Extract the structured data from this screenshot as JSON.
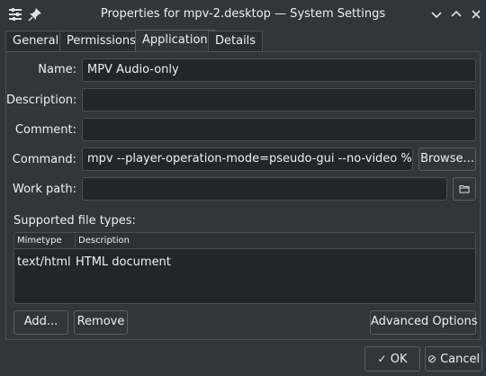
{
  "window": {
    "title": "Properties for mpv-2.desktop — System Settings",
    "icons": [
      "settings-icon",
      "pin-icon",
      "minimize-icon",
      "maximize-icon",
      "close-icon"
    ]
  },
  "tabs": [
    {
      "label": "General",
      "active": false
    },
    {
      "label": "Permissions",
      "active": false
    },
    {
      "label": "Application",
      "active": true
    },
    {
      "label": "Details",
      "active": false
    }
  ],
  "form": {
    "name_label": "Name:",
    "name_value": "MPV Audio-only",
    "description_label": "Description:",
    "description_value": "",
    "comment_label": "Comment:",
    "comment_value": "",
    "command_label": "Command:",
    "command_value": "mpv --player-operation-mode=pseudo-gui --no-video %u",
    "browse_label": "Browse...",
    "workpath_label": "Work path:",
    "workpath_value": ""
  },
  "filetypes": {
    "section_label": "Supported file types:",
    "columns": [
      "Mimetype",
      "Description"
    ],
    "rows": [
      {
        "mimetype": "text/html",
        "description": "HTML document"
      }
    ],
    "add_label": "Add...",
    "remove_label": "Remove",
    "advanced_label": "Advanced Options"
  },
  "footer": {
    "ok_label": "OK",
    "cancel_label": "Cancel"
  },
  "colors": {
    "background": "#31363b",
    "field_background": "#232629",
    "border": "#4a4f54",
    "text": "#eff0f1"
  }
}
